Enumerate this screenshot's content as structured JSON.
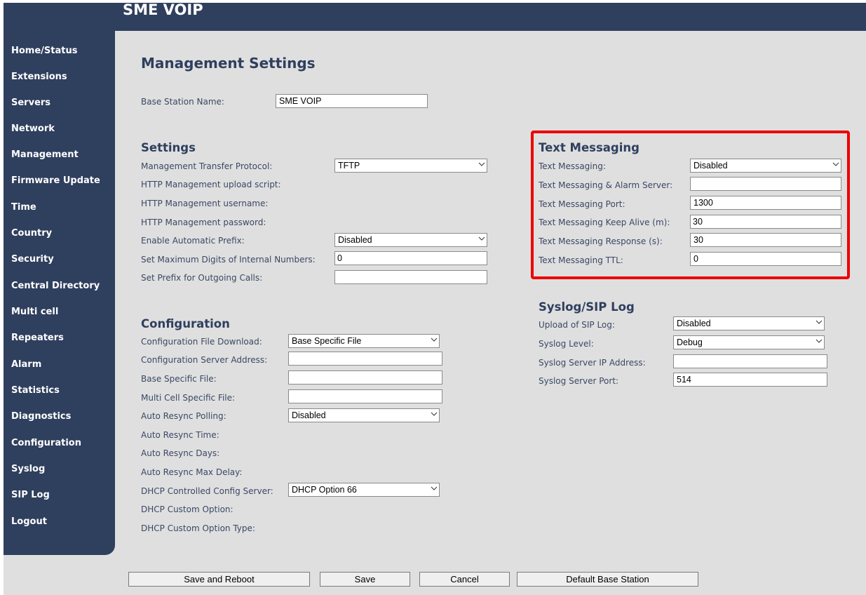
{
  "header": {
    "title": "SME VOIP"
  },
  "sidebar": {
    "items": [
      {
        "label": "Home/Status"
      },
      {
        "label": "Extensions"
      },
      {
        "label": "Servers"
      },
      {
        "label": "Network"
      },
      {
        "label": "Management"
      },
      {
        "label": "Firmware Update"
      },
      {
        "label": "Time"
      },
      {
        "label": "Country"
      },
      {
        "label": "Security"
      },
      {
        "label": "Central Directory"
      },
      {
        "label": "Multi cell"
      },
      {
        "label": "Repeaters"
      },
      {
        "label": "Alarm"
      },
      {
        "label": "Statistics"
      },
      {
        "label": "Diagnostics"
      },
      {
        "label": "Configuration"
      },
      {
        "label": "Syslog"
      },
      {
        "label": "SIP Log"
      },
      {
        "label": "Logout"
      }
    ]
  },
  "page": {
    "title": "Management Settings",
    "base_station_name": {
      "label": "Base Station Name:",
      "value": "SME VOIP"
    }
  },
  "settings": {
    "title": "Settings",
    "transfer_protocol": {
      "label": "Management Transfer Protocol:",
      "value": "TFTP"
    },
    "http_upload_script": {
      "label": "HTTP Management upload script:"
    },
    "http_username": {
      "label": "HTTP Management username:"
    },
    "http_password": {
      "label": "HTTP Management password:"
    },
    "auto_prefix": {
      "label": "Enable Automatic Prefix:",
      "value": "Disabled"
    },
    "max_digits": {
      "label": "Set Maximum Digits of Internal Numbers:",
      "value": "0"
    },
    "outgoing_prefix": {
      "label": "Set Prefix for Outgoing Calls:",
      "value": ""
    }
  },
  "configuration": {
    "title": "Configuration",
    "file_download": {
      "label": "Configuration File Download:",
      "value": "Base Specific File"
    },
    "server_address": {
      "label": "Configuration Server Address:",
      "value": ""
    },
    "base_specific_file": {
      "label": "Base Specific File:",
      "value": ""
    },
    "multi_cell_file": {
      "label": "Multi Cell Specific File:",
      "value": ""
    },
    "auto_resync_polling": {
      "label": "Auto Resync Polling:",
      "value": "Disabled"
    },
    "auto_resync_time": {
      "label": "Auto Resync Time:"
    },
    "auto_resync_days": {
      "label": "Auto Resync Days:"
    },
    "auto_resync_max_delay": {
      "label": "Auto Resync Max Delay:"
    },
    "dhcp_config_server": {
      "label": "DHCP Controlled Config Server:",
      "value": "DHCP Option 66"
    },
    "dhcp_custom_option": {
      "label": "DHCP Custom Option:"
    },
    "dhcp_custom_option_type": {
      "label": "DHCP Custom Option Type:"
    }
  },
  "text_messaging": {
    "title": "Text Messaging",
    "enabled": {
      "label": "Text Messaging:",
      "value": "Disabled"
    },
    "alarm_server": {
      "label": "Text Messaging & Alarm Server:",
      "value": ""
    },
    "port": {
      "label": "Text Messaging Port:",
      "value": "1300"
    },
    "keep_alive": {
      "label": "Text Messaging Keep Alive (m):",
      "value": "30"
    },
    "response": {
      "label": "Text Messaging Response (s):",
      "value": "30"
    },
    "ttl": {
      "label": "Text Messaging TTL:",
      "value": "0"
    },
    "highlight_color": "#ee0000"
  },
  "syslog": {
    "title": "Syslog/SIP Log",
    "upload_sip_log": {
      "label": "Upload of SIP Log:",
      "value": "Disabled"
    },
    "syslog_level": {
      "label": "Syslog Level:",
      "value": "Debug"
    },
    "server_ip": {
      "label": "Syslog Server IP Address:",
      "value": ""
    },
    "server_port": {
      "label": "Syslog Server Port:",
      "value": "514"
    }
  },
  "buttons": {
    "save_reboot": "Save and Reboot",
    "save": "Save",
    "cancel": "Cancel",
    "default_base_station": "Default Base Station"
  },
  "colors": {
    "navy": "#2f3f5e",
    "background": "#dfdfdf",
    "highlight": "#ee0000"
  }
}
